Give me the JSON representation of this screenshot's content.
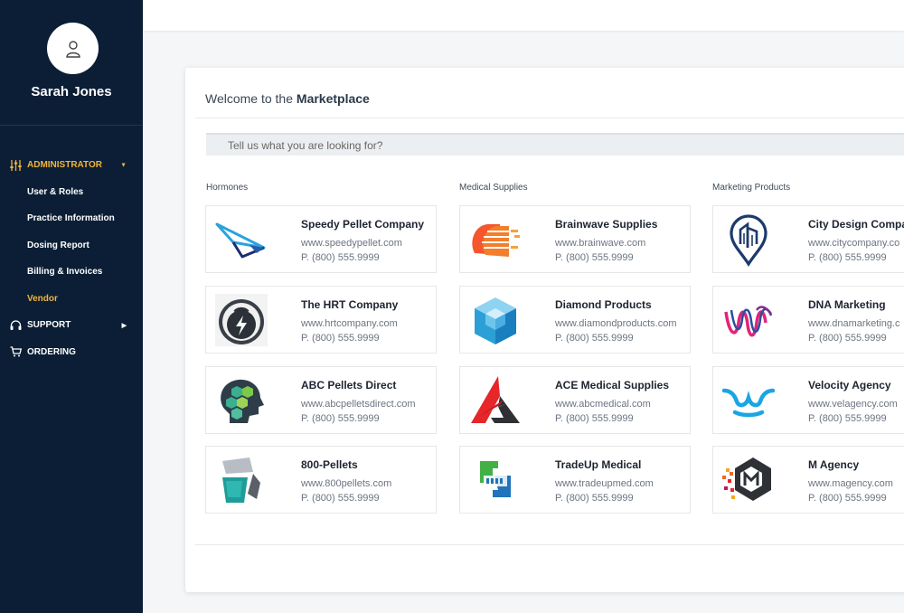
{
  "user": {
    "name": "Sarah Jones"
  },
  "nav": {
    "administrator": "ADMINISTRATOR",
    "sub_items": [
      "User & Roles",
      "Practice Information",
      "Dosing Report",
      "Billing & Invoices",
      "Vendor"
    ],
    "support": "SUPPORT",
    "ordering": "ORDERING"
  },
  "marketplace": {
    "welcome_prefix": "Welcome to the",
    "welcome_bold": "Marketplace",
    "search_placeholder": "Tell us what you are looking for?"
  },
  "columns": [
    {
      "title": "Hormones",
      "vendors": [
        {
          "name": "Speedy Pellet Company",
          "url": "www.speedypellet.com",
          "phone": "P. (800) 555.9999",
          "logo": "paper-plane-logo"
        },
        {
          "name": "The HRT Company",
          "url": "www.hrtcompany.com",
          "phone": "P. (800) 555.9999",
          "logo": "kettlebell-bolt-logo"
        },
        {
          "name": "ABC Pellets Direct",
          "url": "www.abcpelletsdirect.com",
          "phone": "P. (800) 555.9999",
          "logo": "hexagon-head-logo"
        },
        {
          "name": "800-Pellets",
          "url": "www.800pellets.com",
          "phone": "P. (800) 555.9999",
          "logo": "tiles-logo"
        }
      ]
    },
    {
      "title": "Medical Supplies",
      "vendors": [
        {
          "name": "Brainwave Supplies",
          "url": "www.brainwave.com",
          "phone": "P. (800) 555.9999",
          "logo": "brain-heads-logo"
        },
        {
          "name": "Diamond Products",
          "url": "www.diamondproducts.com",
          "phone": "P. (800) 555.9999",
          "logo": "cube-logo"
        },
        {
          "name": "ACE Medical Supplies",
          "url": "www.abcmedical.com",
          "phone": "P. (800) 555.9999",
          "logo": "letter-a-logo"
        },
        {
          "name": "TradeUp Medical",
          "url": "www.tradeupmed.com",
          "phone": "P. (800) 555.9999",
          "logo": "handshake-logo"
        }
      ]
    },
    {
      "title": "Marketing Products",
      "vendors": [
        {
          "name": "City Design Compa",
          "url": "www.citycompany.co",
          "phone": "P. (800) 555.9999",
          "logo": "map-pin-city-logo"
        },
        {
          "name": "DNA Marketing",
          "url": "www.dnamarketing.c",
          "phone": "P. (800) 555.9999",
          "logo": "ribbon-wave-logo"
        },
        {
          "name": "Velocity Agency",
          "url": "www.velagency.com",
          "phone": "P. (800) 555.9999",
          "logo": "wave-logo"
        },
        {
          "name": "M Agency",
          "url": "www.magency.com",
          "phone": "P. (800) 555.9999",
          "logo": "letter-m-hexagon-logo"
        }
      ]
    }
  ],
  "colors": {
    "sidebar": "#0b1e35",
    "accent": "#f0b43c"
  }
}
